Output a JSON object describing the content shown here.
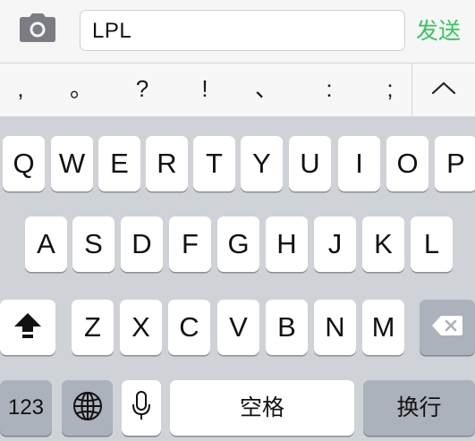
{
  "input_bar": {
    "camera_icon": "camera-icon",
    "text_value": "LPL",
    "send_label": "发送",
    "send_color": "#34c759"
  },
  "punctuation": [
    ",",
    "。",
    "?",
    "!",
    "、",
    ":",
    ";"
  ],
  "collapse_icon": "chevron-up-icon",
  "keyboard": {
    "row1": [
      "Q",
      "W",
      "E",
      "R",
      "T",
      "Y",
      "U",
      "I",
      "O",
      "P"
    ],
    "row2": [
      "A",
      "S",
      "D",
      "F",
      "G",
      "H",
      "J",
      "K",
      "L"
    ],
    "row3": [
      "Z",
      "X",
      "C",
      "V",
      "B",
      "N",
      "M"
    ],
    "shift_icon": "shift-icon",
    "backspace_icon": "backspace-icon",
    "numbers_label": "123",
    "globe_icon": "globe-icon",
    "mic_icon": "microphone-icon",
    "space_label": "空格",
    "return_label": "换行"
  }
}
